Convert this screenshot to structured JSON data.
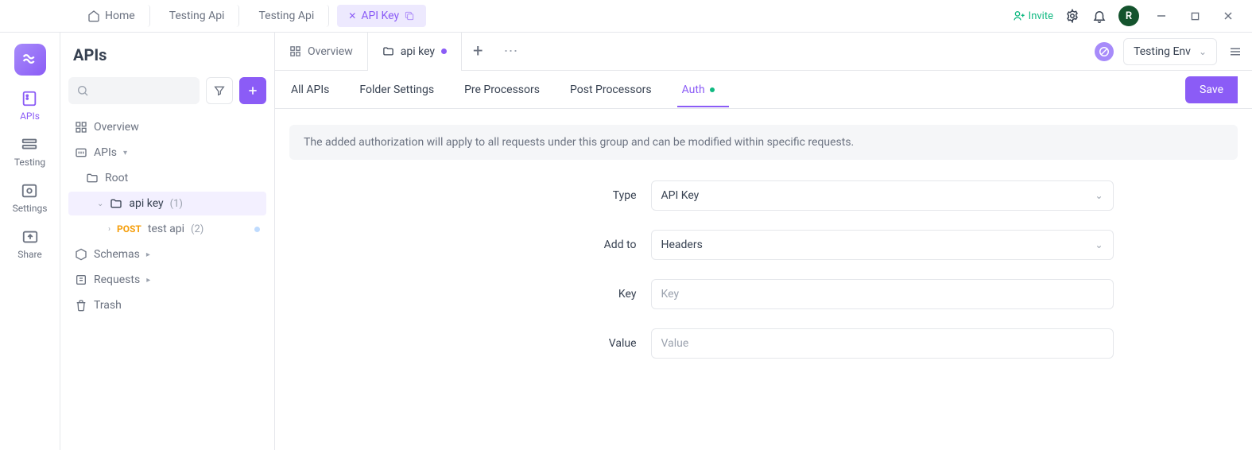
{
  "appTabs": {
    "home": "Home",
    "tabs": [
      "Testing Api",
      "Testing Api"
    ],
    "active": {
      "label": "API Key",
      "closeGlyph": "✕"
    }
  },
  "topRight": {
    "invite": "Invite",
    "avatar": "R"
  },
  "rail": {
    "apis": "APIs",
    "testing": "Testing",
    "settings": "Settings",
    "share": "Share"
  },
  "sidebar": {
    "title": "APIs",
    "overview": "Overview",
    "apisLabel": "APIs",
    "root": "Root",
    "apiKeyFolder": "api key",
    "apiKeyCount": "(1)",
    "request": {
      "method": "POST",
      "name": "test api",
      "count": "(2)"
    },
    "schemas": "Schemas",
    "requests": "Requests",
    "trash": "Trash"
  },
  "docTabs": {
    "overview": "Overview",
    "active": "api key",
    "env": "Testing Env"
  },
  "subnav": {
    "allApis": "All APIs",
    "folderSettings": "Folder Settings",
    "pre": "Pre Processors",
    "post": "Post Processors",
    "auth": "Auth",
    "save": "Save"
  },
  "notice": "The added authorization will apply to all requests under this group and can be modified within specific requests.",
  "form": {
    "typeLabel": "Type",
    "typeValue": "API Key",
    "addToLabel": "Add to",
    "addToValue": "Headers",
    "keyLabel": "Key",
    "keyPlaceholder": "Key",
    "valueLabel": "Value",
    "valuePlaceholder": "Value"
  }
}
